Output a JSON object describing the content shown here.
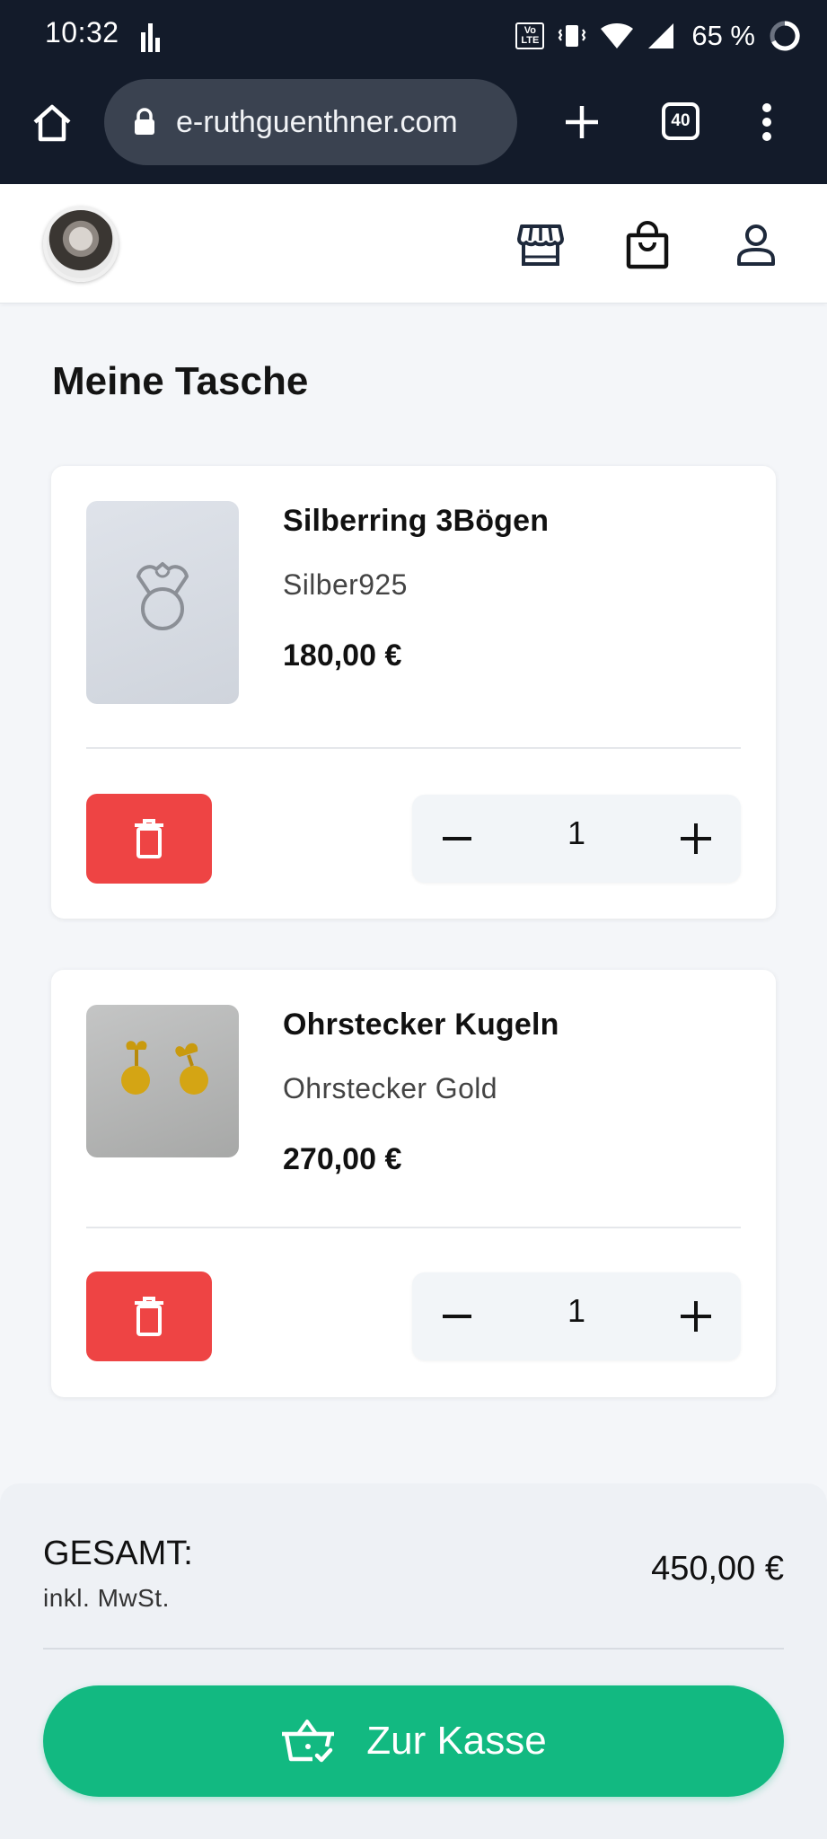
{
  "status_bar": {
    "time": "10:32",
    "volte_line1": "Vo",
    "volte_line2": "LTE",
    "battery": "65 %"
  },
  "browser": {
    "url": "e-ruthguenthner.com",
    "tab_count": "40"
  },
  "page": {
    "title": "Meine Tasche"
  },
  "cart": {
    "items": [
      {
        "name": "Silberring 3Bögen",
        "subtitle": "Silber925",
        "price": "180,00 €",
        "quantity": "1",
        "image_icon": "silver-ring"
      },
      {
        "name": "Ohrstecker Kugeln",
        "subtitle": "Ohrstecker Gold",
        "price": "270,00 €",
        "quantity": "1",
        "image_icon": "gold-earrings"
      }
    ]
  },
  "summary": {
    "total_label": "GESAMT:",
    "tax_note": "inkl. MwSt.",
    "total_value": "450,00 €"
  },
  "checkout": {
    "label": "Zur Kasse"
  },
  "colors": {
    "chrome_bg": "#131b2a",
    "delete_red": "#ee4444",
    "checkout_green": "#12b981",
    "page_bg": "#f4f6f9"
  }
}
